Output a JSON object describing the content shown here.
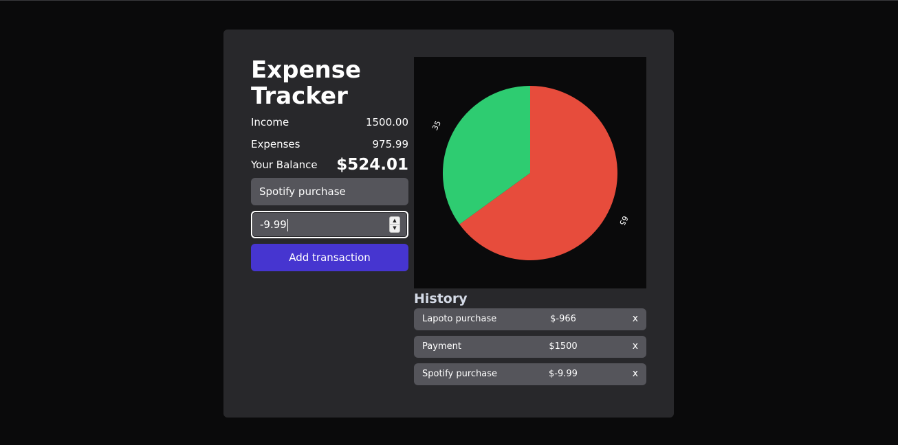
{
  "app": {
    "title": "Expense Tracker"
  },
  "summary": {
    "income_label": "Income",
    "income_value": "1500.00",
    "expenses_label": "Expenses",
    "expenses_value": "975.99",
    "balance_label": "Your Balance",
    "balance_value": "$524.01"
  },
  "form": {
    "description_value": "Spotify purchase",
    "amount_value": "-9.99",
    "submit_label": "Add transaction"
  },
  "chart_data": {
    "type": "pie",
    "slices": [
      {
        "label": "65",
        "value": 65,
        "color": "#e74c3c"
      },
      {
        "label": "35",
        "value": 35,
        "color": "#2ecc71"
      }
    ]
  },
  "history": {
    "title": "History",
    "items": [
      {
        "name": "Lapoto purchase",
        "amount": "$-966",
        "remove": "x"
      },
      {
        "name": "Payment",
        "amount": "$1500",
        "remove": "x"
      },
      {
        "name": "Spotify purchase",
        "amount": "$-9.99",
        "remove": "x"
      }
    ]
  }
}
